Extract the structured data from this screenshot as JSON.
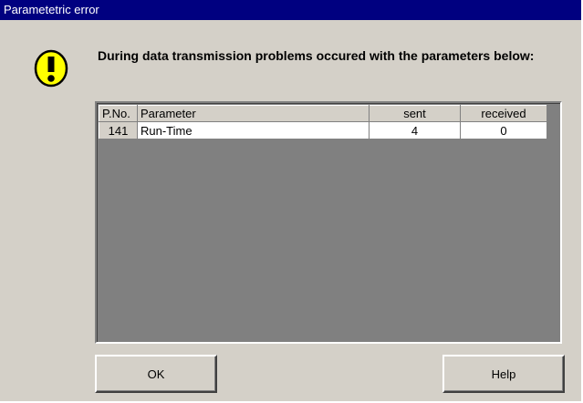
{
  "window": {
    "title": "Parametetric error"
  },
  "icon": {
    "name": "exclamation-warning-icon",
    "fill": "#ffff00"
  },
  "message": "During data transmission problems occured with the parameters below:",
  "table": {
    "headers": {
      "pno": "P.No.",
      "parameter": "Parameter",
      "sent": "sent",
      "received": "received"
    },
    "rows": [
      {
        "pno": "141",
        "parameter": "Run-Time",
        "sent": "4",
        "received": "0"
      }
    ]
  },
  "buttons": {
    "ok": "OK",
    "help": "Help"
  }
}
